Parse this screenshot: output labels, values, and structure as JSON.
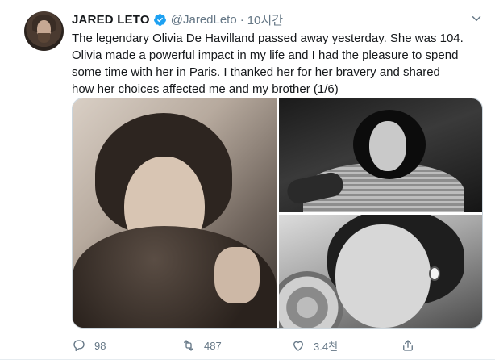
{
  "tweet": {
    "author": {
      "name": "JARED LETO",
      "handle": "@JaredLeto",
      "verified": true
    },
    "separator": "·",
    "time": "10시간",
    "text": "The legendary Olivia De Havilland passed away yesterday. She was 104.\nOlivia made a powerful impact in my life and I had the pleasure to spend\nsome time with her in Paris. I thanked her for her bravery and shared\nhow her choices affected me and my brother (1/6)",
    "actions": {
      "reply_count": "98",
      "retweet_count": "487",
      "like_count": "3.4천"
    }
  },
  "icons": {
    "verified": "verified-badge-icon",
    "caret": "chevron-down-icon",
    "reply": "reply-icon",
    "retweet": "retweet-icon",
    "like": "heart-icon",
    "share": "share-icon"
  },
  "colors": {
    "verified": "#1da1f2",
    "muted": "#657786",
    "text": "#14171a"
  }
}
